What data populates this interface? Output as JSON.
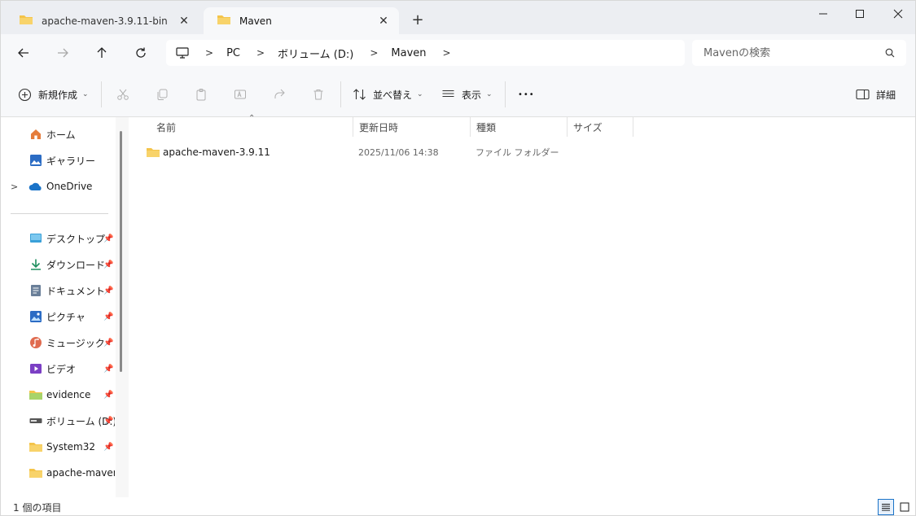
{
  "tabs": [
    {
      "label": "apache-maven-3.9.11-bin",
      "close": "✕"
    },
    {
      "label": "Maven",
      "close": "✕"
    }
  ],
  "new_tab": "+",
  "window_controls": {
    "minimize": "—",
    "maximize": "☐",
    "close": "✕"
  },
  "breadcrumb": [
    "PC",
    "ボリューム (D:)",
    "Maven"
  ],
  "search": {
    "placeholder": "Mavenの検索"
  },
  "commands": {
    "new": "新規作成",
    "sort": "並べ替え",
    "view": "表示",
    "more": "•••",
    "details": "詳細"
  },
  "sidebar": {
    "items": [
      {
        "label": "ホーム",
        "icon": "home-icon"
      },
      {
        "label": "ギャラリー",
        "icon": "gallery-icon"
      },
      {
        "label": "OneDrive",
        "icon": "cloud-icon"
      },
      {
        "label": "デスクトップ",
        "icon": "desktop-icon"
      },
      {
        "label": "ダウンロード",
        "icon": "download-icon"
      },
      {
        "label": "ドキュメント",
        "icon": "document-icon"
      },
      {
        "label": "ピクチャ",
        "icon": "pictures-icon"
      },
      {
        "label": "ミュージック",
        "icon": "music-icon"
      },
      {
        "label": "ビデオ",
        "icon": "video-icon"
      },
      {
        "label": "evidence",
        "icon": "folder-icon"
      },
      {
        "label": "ボリューム (D:)",
        "icon": "drive-icon"
      },
      {
        "label": "System32",
        "icon": "folder-icon"
      },
      {
        "label": "apache-maven-",
        "icon": "folder-icon"
      }
    ]
  },
  "columns": {
    "name": "名前",
    "date": "更新日時",
    "type": "種類",
    "size": "サイズ"
  },
  "files": [
    {
      "name": "apache-maven-3.9.11",
      "date": "2025/11/06 14:38",
      "type": "ファイル フォルダー",
      "size": ""
    }
  ],
  "status": {
    "count": "1 個の項目"
  },
  "colors": {
    "folder": "#f4c44a",
    "accent": "#1a73c8"
  }
}
